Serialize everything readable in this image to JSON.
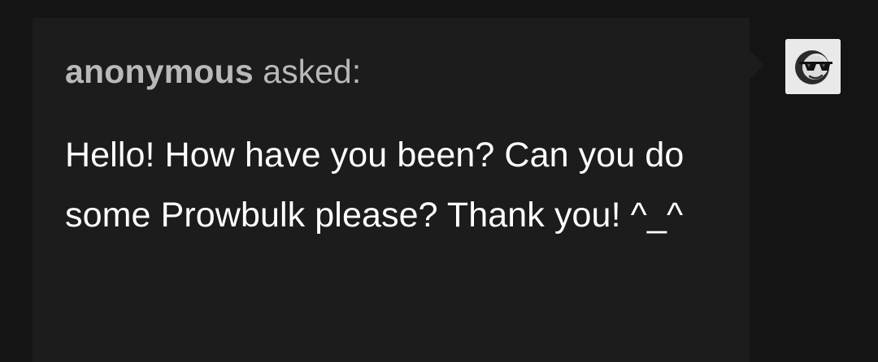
{
  "ask": {
    "asker_name": "anonymous",
    "asked_suffix": " asked:",
    "question_text": "Hello! How have you been? Can you do some Prowbulk please? Thank you! ^_^"
  },
  "avatar": {
    "icon": "anonymous-sunglasses-avatar-icon",
    "background_color": "#e9e9e9"
  },
  "colors": {
    "page_background": "#141414",
    "bubble_background": "#1c1c1c",
    "asker_text": "#b9b9b9",
    "question_text": "#ffffff"
  }
}
